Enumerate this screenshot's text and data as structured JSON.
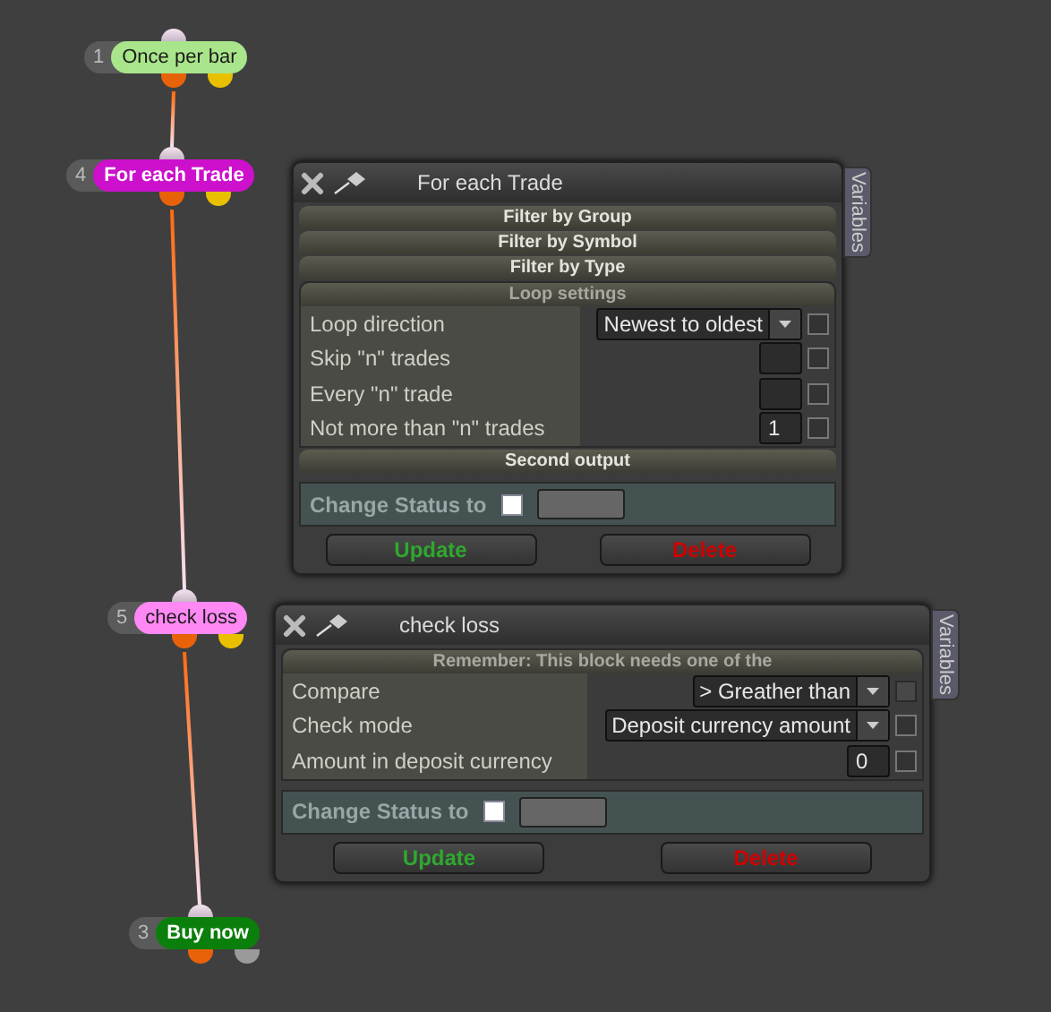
{
  "nodes": [
    {
      "number": "1",
      "label": "Once per bar",
      "color": "#a9e58a",
      "outputs": [
        {
          "color": "#e8620a"
        },
        {
          "color": "#e8c000"
        }
      ]
    },
    {
      "number": "4",
      "label": "For each Trade",
      "color": "#cc10cc",
      "outputs": [
        {
          "color": "#e8620a"
        },
        {
          "color": "#e8c000"
        }
      ]
    },
    {
      "number": "5",
      "label": "check loss",
      "color": "#ff88f4",
      "outputs": [
        {
          "color": "#e8620a"
        },
        {
          "color": "#e8c000"
        }
      ]
    },
    {
      "number": "3",
      "label": "Buy now",
      "color": "#0b7f0b",
      "outputs": [
        {
          "color": "#e8620a"
        },
        {
          "color": "#9a9a9a"
        }
      ]
    }
  ],
  "panels": [
    {
      "title": "For each Trade",
      "side_tab": "Variables",
      "sections": [
        {
          "kind": "header",
          "label": "Filter by Group"
        },
        {
          "kind": "header",
          "label": "Filter by Symbol"
        },
        {
          "kind": "header",
          "label": "Filter by Type"
        },
        {
          "kind": "group",
          "label": "Loop settings",
          "rows": [
            {
              "kind": "select",
              "label": "Loop direction",
              "value": "Newest to oldest",
              "checked": false
            },
            {
              "kind": "input",
              "label": "Skip \"n\" trades",
              "checked": false
            },
            {
              "kind": "input",
              "label": "Every \"n\" trade",
              "checked": false
            },
            {
              "kind": "input",
              "label": "Not more than \"n\" trades",
              "value": "1",
              "checked": false
            }
          ]
        },
        {
          "kind": "header",
          "label": "Second output"
        }
      ],
      "status": {
        "label": "Change Status to",
        "checked": false
      },
      "buttons": [
        {
          "label": "Update",
          "kind": "update"
        },
        {
          "label": "Delete",
          "kind": "delete"
        }
      ]
    },
    {
      "title": "check loss",
      "side_tab": "Variables",
      "sections": [
        {
          "kind": "group",
          "label": "Remember: This block needs one of the",
          "rows": [
            {
              "kind": "select",
              "label": "Compare",
              "value": "> Greather than",
              "checked": false,
              "disabled": true
            },
            {
              "kind": "select",
              "label": "Check mode",
              "value": "Deposit currency amount",
              "checked": false,
              "disabled": false
            },
            {
              "kind": "input",
              "label": "Amount in deposit currency",
              "value": "0",
              "checked": false,
              "disabled": false
            }
          ]
        }
      ],
      "status": {
        "label": "Change Status to",
        "checked": false
      },
      "buttons": [
        {
          "label": "Update",
          "kind": "update"
        },
        {
          "label": "Delete",
          "kind": "delete"
        }
      ]
    }
  ]
}
